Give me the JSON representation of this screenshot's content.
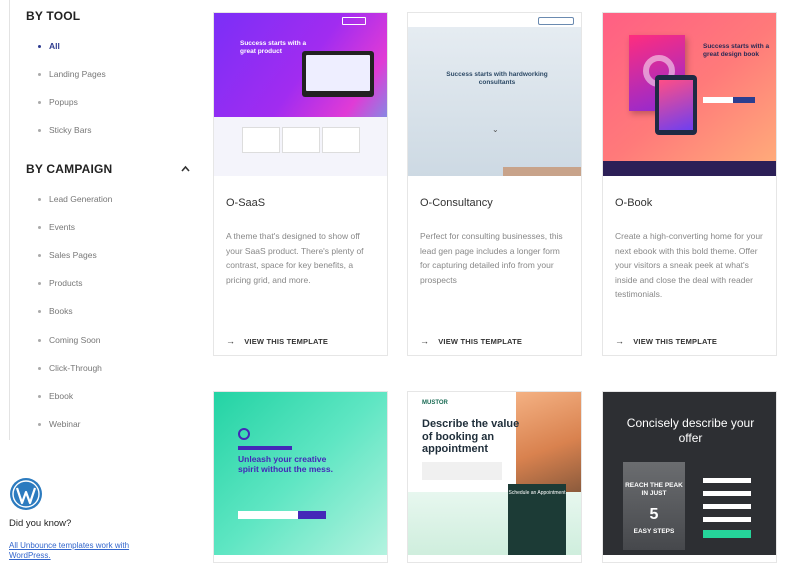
{
  "sidebar": {
    "by_tool": {
      "heading": "BY TOOL",
      "items": [
        {
          "label": "All",
          "active": true
        },
        {
          "label": "Landing Pages"
        },
        {
          "label": "Popups"
        },
        {
          "label": "Sticky Bars"
        }
      ]
    },
    "by_campaign": {
      "heading": "BY CAMPAIGN",
      "collapse_icon": "chevron-up-icon",
      "items": [
        {
          "label": "Lead Generation"
        },
        {
          "label": "Events"
        },
        {
          "label": "Sales Pages"
        },
        {
          "label": "Products"
        },
        {
          "label": "Books"
        },
        {
          "label": "Coming Soon"
        },
        {
          "label": "Click-Through"
        },
        {
          "label": "Ebook"
        },
        {
          "label": "Webinar"
        }
      ]
    },
    "did_you_know": {
      "icon": "wordpress-logo-icon",
      "heading": "Did you know?",
      "link": "All Unbounce templates work with WordPress."
    }
  },
  "cards": [
    {
      "title": "O-SaaS",
      "description": "A theme that's designed to show off your SaaS product. There's plenty of contrast, space for key benefits, a pricing grid, and more.",
      "cta": "VIEW THIS TEMPLATE",
      "thumb_heading": "Success starts with a great product"
    },
    {
      "title": "O-Consultancy",
      "description": "Perfect for consulting businesses, this lead gen page includes a longer form for capturing detailed info from your prospects",
      "cta": "VIEW THIS TEMPLATE",
      "thumb_heading": "Success starts with hardworking consultants"
    },
    {
      "title": "O-Book",
      "description": "Create a high-converting home for your next ebook with this bold theme. Offer your visitors a sneak peek at what's inside and close the deal with reader testimonials.",
      "cta": "VIEW THIS TEMPLATE",
      "thumb_heading": "Success starts with a great design book"
    }
  ],
  "row2": [
    {
      "thumb_heading": "Unleash your creative spirit without the mess."
    },
    {
      "thumb_brand": "MUSTOR",
      "thumb_heading": "Describe the value of booking an appointment",
      "thumb_form": "Schedule an Appointment"
    },
    {
      "thumb_heading": "Concisely describe your offer",
      "thumb_book_top": "REACH THE PEAK IN JUST",
      "thumb_book_big": "5",
      "thumb_book_bottom": "EASY STEPS"
    }
  ],
  "colors": {
    "accent_nav": "#2e3b8f",
    "link": "#3366cc",
    "green_brand": "#25d59a"
  }
}
